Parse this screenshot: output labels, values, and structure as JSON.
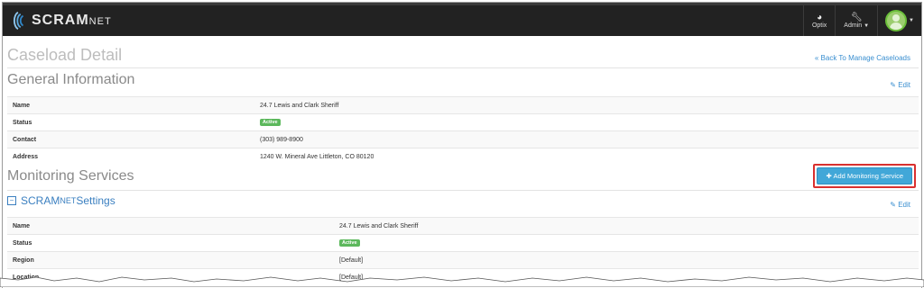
{
  "navbar": {
    "brand_main": "SCRAM",
    "brand_suffix": "NET",
    "optix_label": "Optix",
    "admin_label": "Admin"
  },
  "page": {
    "title": "Caseload Detail",
    "back_link": "« Back To Manage Caseloads"
  },
  "general": {
    "title": "General Information",
    "edit_label": "Edit",
    "rows": [
      {
        "label": "Name",
        "value": "24.7 Lewis and Clark Sheriff"
      },
      {
        "label": "Status",
        "value": "Active"
      },
      {
        "label": "Contact",
        "value": "(303) 989-8900"
      },
      {
        "label": "Address",
        "value": "1240 W. Mineral Ave Littleton, CO 80120"
      }
    ]
  },
  "monitoring": {
    "title": "Monitoring Services",
    "add_button": "Add Monitoring Service",
    "settings_title_main": "SCRAM",
    "settings_title_suffix": "NET",
    "settings_title_rest": " Settings",
    "edit_label": "Edit",
    "rows": [
      {
        "label": "Name",
        "value": "24.7 Lewis and Clark Sheriff"
      },
      {
        "label": "Status",
        "value": "Active"
      },
      {
        "label": "Region",
        "value": "[Default]"
      },
      {
        "label": "Location",
        "value": "[Default]"
      }
    ]
  },
  "colors": {
    "navbar": "#222222",
    "link": "#3a8fd0",
    "badge_active": "#5cb85c",
    "button_primary": "#41a7d8",
    "highlight": "#d9302f"
  }
}
